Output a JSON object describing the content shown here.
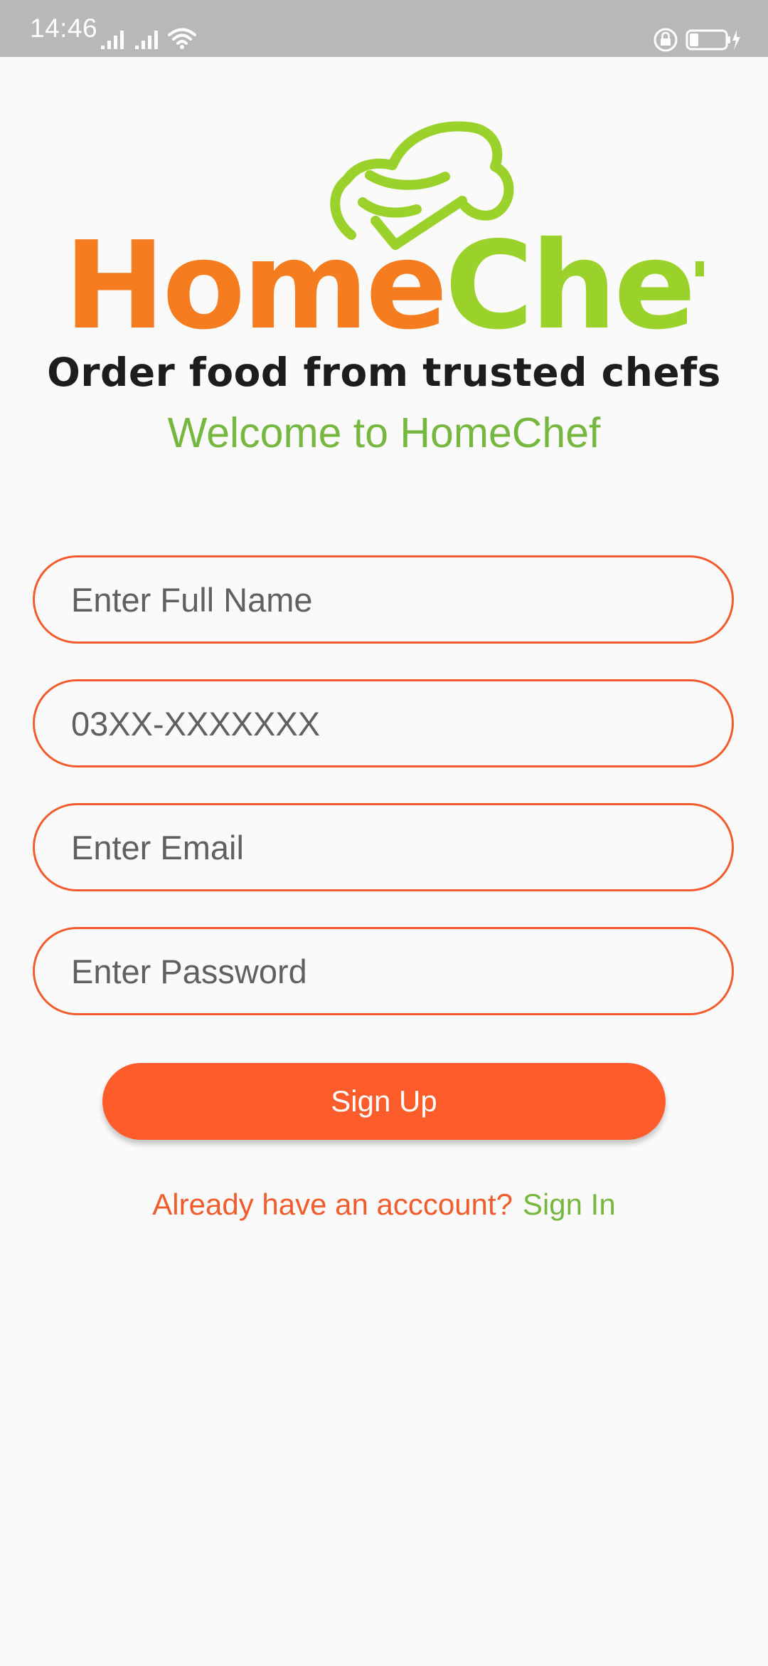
{
  "status_bar": {
    "time": "14:46",
    "icons": [
      "signal-icon",
      "signal-icon",
      "wifi-icon",
      "rotation-lock-icon",
      "battery-charging-icon"
    ]
  },
  "logo": {
    "word_home": "Home",
    "word_chef": "Chef",
    "home_color": "#f57c1f",
    "chef_color": "#9ad22b",
    "icon": "chef-hat-icon"
  },
  "tagline": "Order food from trusted chefs",
  "welcome": "Welcome to HomeChef",
  "form": {
    "full_name": {
      "placeholder": "Enter Full Name",
      "value": ""
    },
    "phone": {
      "placeholder": "03XX-XXXXXXX",
      "value": ""
    },
    "email": {
      "placeholder": "Enter Email",
      "value": ""
    },
    "password": {
      "placeholder": "Enter Password",
      "value": ""
    }
  },
  "signup_button": "Sign Up",
  "signin": {
    "prompt": "Already have an acccount?",
    "link": "Sign In"
  },
  "colors": {
    "accent": "#ff5c2c",
    "green": "#76b83f",
    "background": "#fafafa"
  }
}
